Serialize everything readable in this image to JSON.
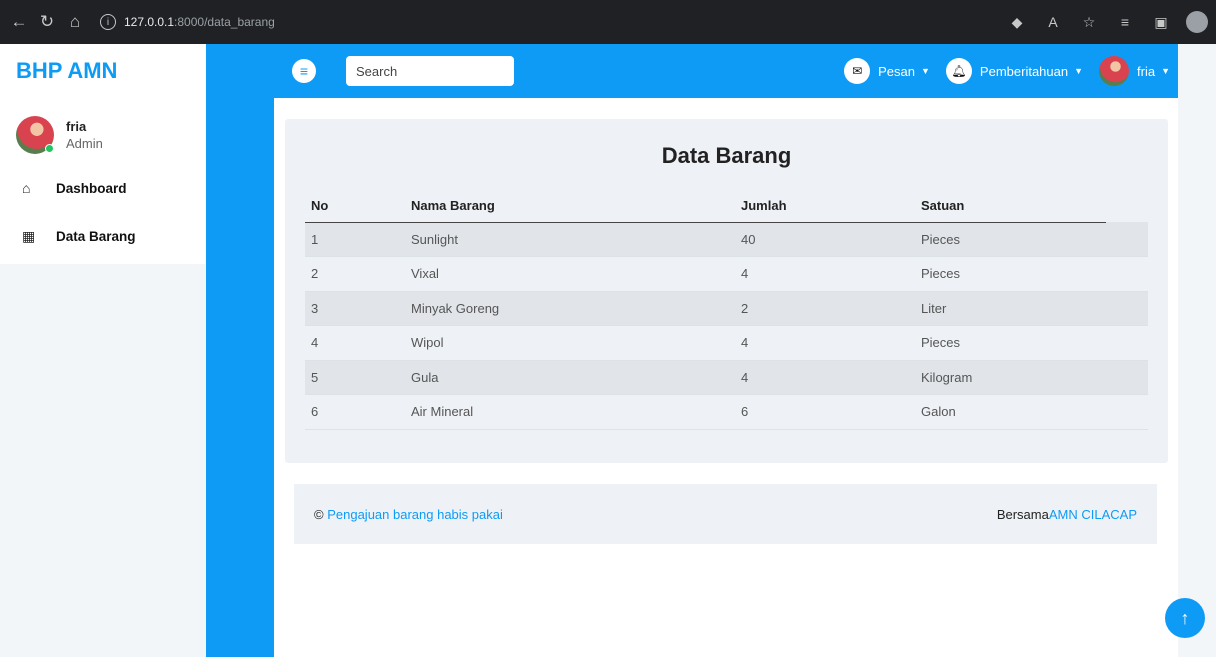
{
  "browser": {
    "url_host": "127.0.0.1",
    "url_path": ":8000/data_barang"
  },
  "sidebar": {
    "brand": "BHP AMN",
    "user": {
      "name": "fria",
      "role": "Admin"
    },
    "items": [
      {
        "label": "Dashboard",
        "icon": "home-icon"
      },
      {
        "label": "Data Barang",
        "icon": "grid-icon"
      }
    ]
  },
  "topbar": {
    "search_placeholder": "Search",
    "messages_label": "Pesan",
    "notifications_label": "Pemberitahuan",
    "user_label": "fria"
  },
  "main": {
    "title": "Data Barang",
    "table": {
      "headers": [
        "No",
        "Nama Barang",
        "Jumlah",
        "Satuan"
      ],
      "rows": [
        [
          "1",
          "Sunlight",
          "40",
          "Pieces"
        ],
        [
          "2",
          "Vixal",
          "4",
          "Pieces"
        ],
        [
          "3",
          "Minyak Goreng",
          "2",
          "Liter"
        ],
        [
          "4",
          "Wipol",
          "4",
          "Pieces"
        ],
        [
          "5",
          "Gula",
          "4",
          "Kilogram"
        ],
        [
          "6",
          "Air Mineral",
          "6",
          "Galon"
        ]
      ]
    }
  },
  "footer": {
    "copyright_symbol": "©",
    "left_link": "Pengajuan barang habis pakai",
    "right_prefix": "Bersama",
    "right_link": "AMN CILACAP"
  },
  "colors": {
    "accent": "#0d9bf5",
    "background": "#f3f6f9"
  }
}
